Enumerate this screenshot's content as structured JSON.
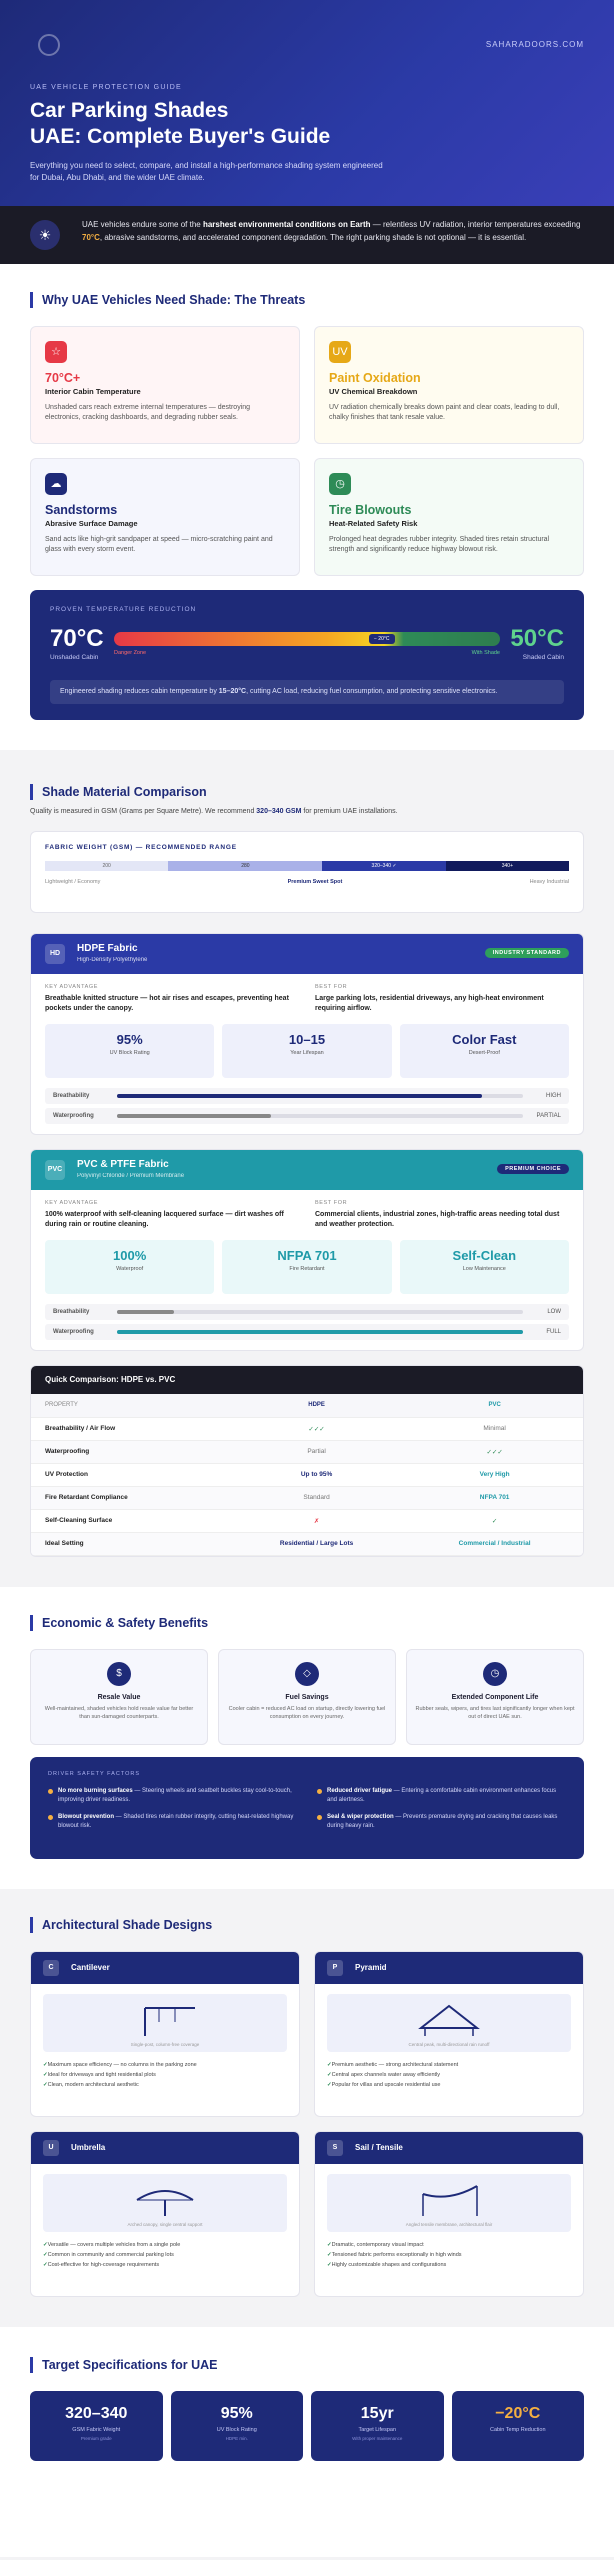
{
  "hero": {
    "domain": "SAHARADOORS.COM",
    "kicker": "UAE VEHICLE PROTECTION GUIDE",
    "title_line1": "Car Parking Shades",
    "title_line2": "UAE: Complete Buyer's Guide",
    "intro": "Everything you need to select, compare, and install a high-performance shading system engineered for Dubai, Abu Dhabi, and the wider UAE climate."
  },
  "alert": {
    "pre": "UAE vehicles endure some of the ",
    "bold": "harshest environmental conditions on Earth",
    "mid": " — relentless UV radiation, interior temperatures exceeding ",
    "temp": "70°C",
    "post": ", abrasive sandstorms, and accelerated component degradation. The right parking shade is not optional — it is essential."
  },
  "threats": {
    "heading": "Why UAE Vehicles Need Shade: The Threats",
    "items": [
      {
        "title": "70°C+",
        "sub": "Interior Cabin Temperature",
        "text": "Unshaded cars reach extreme internal temperatures — destroying electronics, cracking dashboards, and degrading rubber seals.",
        "color": "#e63946",
        "bg": "#fff5f6",
        "icon": "☆"
      },
      {
        "title": "Paint Oxidation",
        "sub": "UV Chemical Breakdown",
        "text": "UV radiation chemically breaks down paint and clear coats, leading to dull, chalky finishes that tank resale value.",
        "color": "#e6a817",
        "bg": "#fffcf0",
        "icon": "UV"
      },
      {
        "title": "Sandstorms",
        "sub": "Abrasive Surface Damage",
        "text": "Sand acts like high-grit sandpaper at speed — micro-scratching paint and glass with every storm event.",
        "color": "#1e2a78",
        "bg": "#f5f6fd",
        "icon": "☁"
      },
      {
        "title": "Tire Blowouts",
        "sub": "Heat-Related Safety Risk",
        "text": "Prolonged heat degrades rubber integrity. Shaded tires retain structural strength and significantly reduce highway blowout risk.",
        "color": "#2e8b57",
        "bg": "#f4fbf6",
        "icon": "◷"
      }
    ]
  },
  "temp": {
    "kicker": "PROVEN TEMPERATURE REDUCTION",
    "left": "70°C",
    "left_label": "Unshaded Cabin",
    "right": "50°C",
    "right_label": "Shaded Cabin",
    "danger": "Danger Zone",
    "safe": "With Shade",
    "marker": "− 20°C",
    "note_pre": "Engineered shading reduces cabin temperature by ",
    "note_bold": "15–20°C",
    "note_post": ", cutting AC load, reducing fuel consumption, and protecting sensitive electronics."
  },
  "materials": {
    "heading": "Shade Material Comparison",
    "intro_pre": "Quality is measured in GSM (Grams per Square Metre). We recommend ",
    "intro_bold": "320–340 GSM",
    "intro_post": " for premium UAE installations.",
    "gsm": {
      "title": "FABRIC WEIGHT (GSM) — RECOMMENDED RANGE",
      "segments": [
        "200",
        "280",
        "320–340 ✓",
        "340+"
      ],
      "left": "Lightweight / Economy",
      "mid": "Premium Sweet Spot",
      "right": "Heavy Industrial"
    },
    "hdpe": {
      "abbr": "HD",
      "name": "HDPE Fabric",
      "sub": "High-Density Polyethylene",
      "badge": "INDUSTRY STANDARD",
      "adv_k": "KEY ADVANTAGE",
      "adv": "Breathable knitted structure — hot air rises and escapes, preventing heat pockets under the canopy.",
      "best_k": "BEST FOR",
      "best": "Large parking lots, residential driveways, any high-heat environment requiring airflow.",
      "stats": [
        {
          "n": "95%",
          "l": "UV Block Rating"
        },
        {
          "n": "10–15",
          "l": "Year Lifespan"
        },
        {
          "n": "Color Fast",
          "l": "Desert-Proof"
        }
      ],
      "meters": [
        {
          "l": "Breathability",
          "v": "HIGH",
          "fill": 0.9
        },
        {
          "l": "Waterproofing",
          "v": "PARTIAL",
          "fill": 0.38
        }
      ]
    },
    "pvc": {
      "abbr": "PVC",
      "name": "PVC & PTFE Fabric",
      "sub": "Polyvinyl Chloride / Premium Membrane",
      "badge": "PREMIUM CHOICE",
      "adv_k": "KEY ADVANTAGE",
      "adv": "100% waterproof with self-cleaning lacquered surface — dirt washes off during rain or routine cleaning.",
      "best_k": "BEST FOR",
      "best": "Commercial clients, industrial zones, high-traffic areas needing total dust and weather protection.",
      "stats": [
        {
          "n": "100%",
          "l": "Waterproof"
        },
        {
          "n": "NFPA 701",
          "l": "Fire Retardant"
        },
        {
          "n": "Self-Clean",
          "l": "Low Maintenance"
        }
      ],
      "meters": [
        {
          "l": "Breathability",
          "v": "LOW",
          "fill": 0.14
        },
        {
          "l": "Waterproofing",
          "v": "FULL",
          "fill": 1
        }
      ]
    }
  },
  "compare": {
    "title": "Quick Comparison: HDPE vs. PVC",
    "head": [
      "PROPERTY",
      "HDPE",
      "PVC"
    ],
    "rows": [
      [
        "Breathability / Air Flow",
        "✓✓✓",
        "Minimal"
      ],
      [
        "Waterproofing",
        "Partial",
        "✓✓✓"
      ],
      [
        "UV Protection",
        "Up to 95%",
        "Very High"
      ],
      [
        "Fire Retardant Compliance",
        "Standard",
        "NFPA 701"
      ],
      [
        "Self-Cleaning Surface",
        "✗",
        "✓"
      ],
      [
        "Ideal Setting",
        "Residential / Large Lots",
        "Commercial / Industrial"
      ]
    ]
  },
  "benefits": {
    "heading": "Economic & Safety Benefits",
    "items": [
      {
        "icon": "$",
        "t": "Resale Value",
        "p": "Well-maintained, shaded vehicles hold resale value far better than sun-damaged counterparts."
      },
      {
        "icon": "◇",
        "t": "Fuel Savings",
        "p": "Cooler cabin = reduced AC load on startup, directly lowering fuel consumption on every journey."
      },
      {
        "icon": "◷",
        "t": "Extended Component Life",
        "p": "Rubber seals, wipers, and tires last significantly longer when kept out of direct UAE sun."
      }
    ],
    "driver": {
      "t": "DRIVER SAFETY FACTORS",
      "items": [
        {
          "b": "No more burning surfaces",
          "p": " — Steering wheels and seatbelt buckles stay cool-to-touch, improving driver readiness."
        },
        {
          "b": "Reduced driver fatigue",
          "p": " — Entering a comfortable cabin environment enhances focus and alertness."
        },
        {
          "b": "Blowout prevention",
          "p": " — Shaded tires retain rubber integrity, cutting heat-related highway blowout risk."
        },
        {
          "b": "Seal & wiper protection",
          "p": " — Prevents premature drying and cracking that causes leaks during heavy rain."
        }
      ]
    }
  },
  "designs": {
    "heading": "Architectural Shade Designs",
    "items": [
      {
        "b": "C",
        "t": "Cantilever",
        "cap": "Single-post, column-free coverage",
        "li": [
          "Maximum space efficiency — no columns in the parking zone",
          "Ideal for driveways and tight residential plots",
          "Clean, modern architectural aesthetic"
        ]
      },
      {
        "b": "P",
        "t": "Pyramid",
        "cap": "Central peak, multi-directional rain runoff",
        "li": [
          "Premium aesthetic — strong architectural statement",
          "Central apex channels water away efficiently",
          "Popular for villas and upscale residential use"
        ]
      },
      {
        "b": "U",
        "t": "Umbrella",
        "cap": "Arched canopy, single central support",
        "li": [
          "Versatile — covers multiple vehicles from a single pole",
          "Common in community and commercial parking lots",
          "Cost-effective for high-coverage requirements"
        ]
      },
      {
        "b": "S",
        "t": "Sail / Tensile",
        "cap": "Angled tensile membrane, architectural flair",
        "li": [
          "Dramatic, contemporary visual impact",
          "Tensioned fabric performs exceptionally in high winds",
          "Highly customizable shapes and configurations"
        ]
      }
    ]
  },
  "targets": {
    "heading": "Target Specifications for UAE",
    "items": [
      {
        "n": "320–340",
        "l": "GSM Fabric Weight",
        "s": "Premium grade",
        "c": "#ffffff"
      },
      {
        "n": "95%",
        "l": "UV Block Rating",
        "s": "HDPE min.",
        "c": "#ffffff"
      },
      {
        "n": "15yr",
        "l": "Target Lifespan",
        "s": "With proper maintenance",
        "c": "#ffffff"
      },
      {
        "n": "−20°C",
        "l": "Cabin Temp Reduction",
        "s": "",
        "c": "#f5b042"
      }
    ]
  }
}
